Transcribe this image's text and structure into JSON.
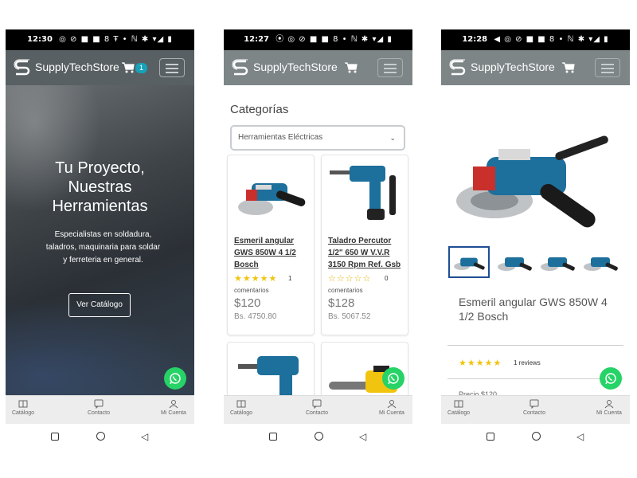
{
  "brand_name": "SupplyTechStore",
  "colors": {
    "header_bg": "#7d8587",
    "accent": "#17a2b8",
    "star": "#f1c40f",
    "whatsapp": "#25d366"
  },
  "icons": [
    "logo-s-icon",
    "cart-icon",
    "hamburger-icon",
    "whatsapp-icon",
    "book-icon",
    "chat-icon",
    "user-icon"
  ],
  "screens": [
    {
      "status_time": "12:30",
      "status_icons": "◎ ⊘ ■ ■ 8 Ŧ • ℕ ✱ ▾◢ ▮",
      "cart_count": "1",
      "hero": {
        "title": "Tu Proyecto, Nuestras Herramientas",
        "subtitle": "Especialistas en soldadura, taladros, maquinaria para soldar y ferreteria en general.",
        "cta": "Ver Catálogo"
      }
    },
    {
      "status_time": "12:27",
      "status_icons": "⦿ ◎ ⊘ ■ ■ 8 • ℕ ✱ ▾◢ ▮",
      "categories_title": "Categorías",
      "category_selected": "Herramientas Eléctricas",
      "products": [
        {
          "name": "Esmeril angular GWS 850W 4 1/2 Bosch",
          "stars": "★★★★★",
          "rating_count": "1",
          "reviews_word": "comentarios",
          "price": "$120",
          "price_bs": "Bs. 4750.80"
        },
        {
          "name": "Taladro Percutor 1/2\" 650 W V.V.R 3150 Rpm Ref. Gsb",
          "stars": "☆☆☆☆☆",
          "rating_count": "0",
          "reviews_word": "comentarios",
          "price": "$128",
          "price_bs": "Bs. 5067.52"
        }
      ]
    },
    {
      "status_time": "12:28",
      "status_icons": "◀ ◎ ⊘ ■ ■ 8 • ℕ ✱ ▾◢ ▮",
      "product_title": "Esmeril angular GWS 850W 4 1/2 Bosch",
      "stars": "★★★★★",
      "reviews": "1 reviews",
      "price_partial": "Precio $120",
      "carousel_dots": "● ● ● ● ● ●"
    }
  ],
  "bottom_nav": {
    "catalog": "Catálogo",
    "contact": "Contacto",
    "account": "Mi Cuenta"
  }
}
